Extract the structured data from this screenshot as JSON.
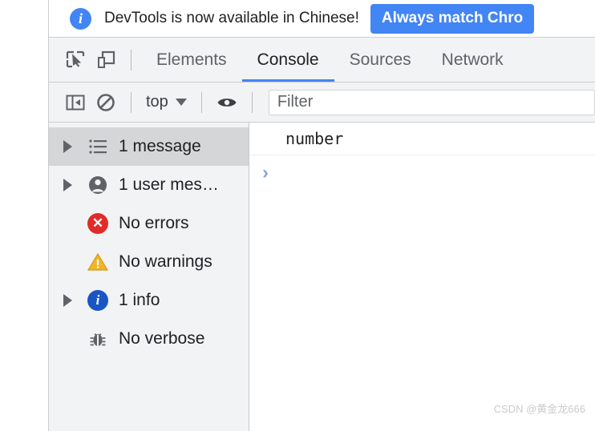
{
  "banner": {
    "icon": "info-circle-icon",
    "message": "DevTools is now available in Chinese!",
    "button_label": "Always match Chro",
    "accent_color": "#4285f4"
  },
  "tabbar": {
    "inspect_icon": "inspect-element-icon",
    "device_icon": "device-toolbar-icon",
    "tabs": [
      {
        "label": "Elements",
        "active": false
      },
      {
        "label": "Console",
        "active": true
      },
      {
        "label": "Sources",
        "active": false
      },
      {
        "label": "Network",
        "active": false
      }
    ],
    "active_underline_color": "#4285f4"
  },
  "console_toolbar": {
    "sidebar_toggle_icon": "show-console-sidebar-icon",
    "clear_icon": "clear-console-icon",
    "context_label": "top",
    "context_caret_icon": "chevron-down-icon",
    "eye_icon": "live-expression-eye-icon",
    "filter_placeholder": "Filter",
    "filter_value": ""
  },
  "sidebar": {
    "items": [
      {
        "label": "1 message",
        "icon": "message-list-icon",
        "expandable": true,
        "selected": true
      },
      {
        "label": "1 user mes…",
        "icon": "user-message-icon",
        "expandable": true,
        "selected": false
      },
      {
        "label": "No errors",
        "icon": "error-icon",
        "expandable": false,
        "selected": false
      },
      {
        "label": "No warnings",
        "icon": "warning-icon",
        "expandable": false,
        "selected": false
      },
      {
        "label": "1 info",
        "icon": "info-icon",
        "expandable": true,
        "selected": false
      },
      {
        "label": "No verbose",
        "icon": "verbose-bug-icon",
        "expandable": false,
        "selected": false
      }
    ],
    "error_color": "#e02b28",
    "warning_color": "#f2b529",
    "info_color": "#1a55c4"
  },
  "console_output": {
    "messages": [
      {
        "text": "number"
      }
    ],
    "prompt_symbol": "›"
  },
  "watermark": {
    "text": "CSDN @黄金龙666"
  }
}
